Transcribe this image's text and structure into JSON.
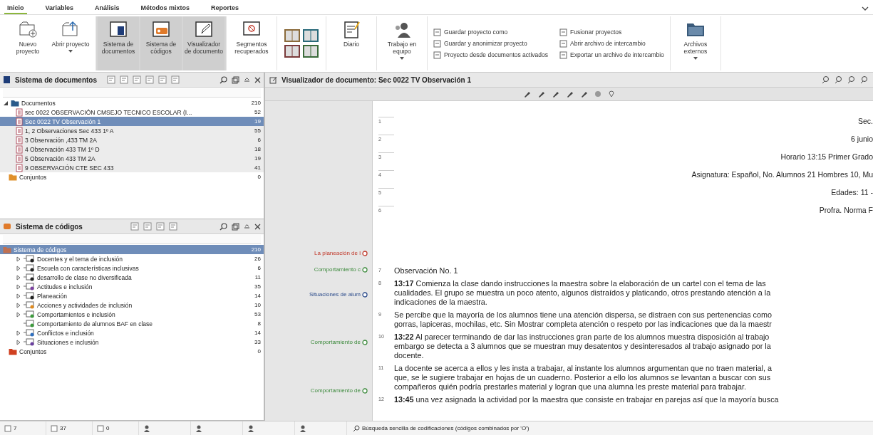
{
  "tabs": [
    {
      "label": "Inicio",
      "selected": true
    },
    {
      "label": "Variables",
      "selected": false
    },
    {
      "label": "Análisis",
      "selected": false
    },
    {
      "label": "Métodos mixtos",
      "selected": false
    },
    {
      "label": "Reportes",
      "selected": false
    }
  ],
  "ribbon": {
    "large_buttons": [
      {
        "label": "Nuevo proyecto",
        "selected": false,
        "dropdown": false
      },
      {
        "label": "Abrir proyecto",
        "selected": false,
        "dropdown": true
      },
      {
        "label": "Sistema de documentos",
        "selected": true,
        "dropdown": false
      },
      {
        "label": "Sistema de códigos",
        "selected": true,
        "dropdown": false
      },
      {
        "label": "Visualizador de documento",
        "selected": true,
        "dropdown": false
      },
      {
        "label": "Segmentos recuperados",
        "selected": false,
        "dropdown": false
      },
      {
        "label": "Diario",
        "selected": false,
        "dropdown": false
      },
      {
        "label": "Trabajo en equipo",
        "selected": false,
        "dropdown": true
      }
    ],
    "small_buttons": [
      [
        "Guardar proyecto como",
        "Guardar y anonimizar proyecto",
        "Proyecto desde documentos activados"
      ],
      [
        "Fusionar proyectos",
        "Abrir archivo de intercambio",
        "Exportar un archivo de intercambio"
      ]
    ],
    "end_button": {
      "label": "Archivos externos",
      "dropdown": true
    }
  },
  "document_system": {
    "title": "Sistema de documentos",
    "root": {
      "label": "Documentos",
      "count": "210",
      "expanded": true
    },
    "documents": [
      {
        "label": "sec 0022 OBSERVACIÓN CMSEJO TECNICO ESCOLAR (I...",
        "count": "52",
        "selected": false
      },
      {
        "label": "Sec 0022 TV Observación 1",
        "count": "19",
        "selected": true
      },
      {
        "label": "1, 2 Observaciones Sec 433  1º A",
        "count": "55",
        "selected": false
      },
      {
        "label": "3 Observación ,433 TM 2A",
        "count": "6",
        "selected": false
      },
      {
        "label": "4 Observación 433 TM 1º D",
        "count": "18",
        "selected": false
      },
      {
        "label": "5 Observación 433 TM 2A",
        "count": "19",
        "selected": false
      },
      {
        "label": "9 OBSERVACIÓN CTE SEC 433",
        "count": "41",
        "selected": false
      }
    ],
    "sets": {
      "label": "Conjuntos",
      "count": "0"
    }
  },
  "code_system": {
    "title": "Sistema de códigos",
    "root": {
      "label": "Sistema de códigos",
      "count": "210",
      "selected": true
    },
    "codes": [
      {
        "label": "Docentes y el tema de inclusión",
        "count": "26",
        "color": "#222222",
        "expanded": false
      },
      {
        "label": "Escuela con características inclusivas",
        "count": "6",
        "color": "#222222",
        "expanded": false
      },
      {
        "label": "desarrollo de clase no diversificada",
        "count": "11",
        "color": "#222222",
        "expanded": false
      },
      {
        "label": "Actitudes e inclusión",
        "count": "35",
        "color": "#7b3fa0",
        "expanded": false
      },
      {
        "label": "Planeación",
        "count": "14",
        "color": "#222222",
        "expanded": false
      },
      {
        "label": "Acciones y actividades de inclusión",
        "count": "10",
        "color": "#e08a1e",
        "expanded": false
      },
      {
        "label": "Comportamientos e inclusión",
        "count": "53",
        "color": "#3c9a3c",
        "expanded": false
      },
      {
        "label": "Comportamiento de alumnos BAF en clase",
        "count": "8",
        "color": "#3c9a3c"
      },
      {
        "label": "Conflictos e inclusión",
        "count": "14",
        "color": "#2e6fc0",
        "expanded": false
      },
      {
        "label": "Situaciones e inclusión",
        "count": "33",
        "color": "#6a3fa0",
        "expanded": false
      }
    ],
    "sets": {
      "label": "Conjuntos",
      "count": "0"
    }
  },
  "viewer": {
    "title": "Visualizador de documento: Sec 0022 TV Observación 1",
    "codings": [
      {
        "label": "La planeación de l",
        "color": "#c0392b"
      },
      {
        "label": "Comportamiento c",
        "color": "#3c8a3c"
      },
      {
        "label": "Situaciones de alum",
        "color": "#2a4a8a"
      },
      {
        "label": "Comportamiento de",
        "color": "#3c8a3c"
      },
      {
        "label": "Comportamiento de",
        "color": "#3c8a3c"
      }
    ],
    "header_lines": [
      {
        "number": "1",
        "text": "Sec."
      },
      {
        "number": "2",
        "text": "6 junio"
      },
      {
        "number": "3",
        "text": "Horario 13:15  Primer Grado"
      },
      {
        "number": "4",
        "text": "Asignatura: Español,     No. Alumnos 21 Hombres 10, Mu"
      },
      {
        "number": "5",
        "text": "Edades: 11 -"
      },
      {
        "number": "6",
        "text": "Profra.  Norma F"
      }
    ],
    "paragraphs": [
      {
        "number": "7",
        "lines": [
          "Observación No. 1"
        ]
      },
      {
        "number": "8",
        "lines": [
          "**13:17**    Comienza la clase dando instrucciones la maestra sobre la elaboración de un cartel con el tema de las",
          "cualidades. El grupo se muestra un poco atento, algunos distraídos y platicando, otros prestando atención a la",
          "indicaciones de la maestra."
        ]
      },
      {
        "number": "9",
        "lines": [
          "Se percibe que la mayoría de los alumnos tiene una atención dispersa, se distraen con sus pertenencias como",
          "gorras, lapiceras, mochilas, etc. Sin Mostrar completa atención o respeto por las indicaciones que da la maestr"
        ]
      },
      {
        "number": "10",
        "lines": [
          "**13:22** Al parecer terminando de dar las instrucciones gran parte de los alumnos muestra disposición al trabajo",
          "embargo se detecta a 3 alumnos que se muestran muy desatentos y desinteresados al trabajo asignado por la",
          "docente."
        ]
      },
      {
        "number": "11",
        "lines": [
          "La docente se acerca a ellos y les insta a trabajar, al instante los alumnos argumentan que no traen material, a",
          "que, se le sugiere trabajar en hojas de un cuaderno. Posterior a ello los alumnos se levantan a buscar con sus",
          "compañeros quién podría prestarles material y logran que una alumna les preste material para trabajar."
        ]
      },
      {
        "number": "12",
        "lines": [
          "**13:45** una vez asignada la actividad por la maestra que consiste en trabajar en parejas así que la mayoría busca"
        ]
      }
    ]
  },
  "status_bar": {
    "counts": [
      "7",
      "37",
      "0"
    ],
    "message": "Búsqueda sencilla de codificaciones (códigos combinados por 'O')"
  }
}
